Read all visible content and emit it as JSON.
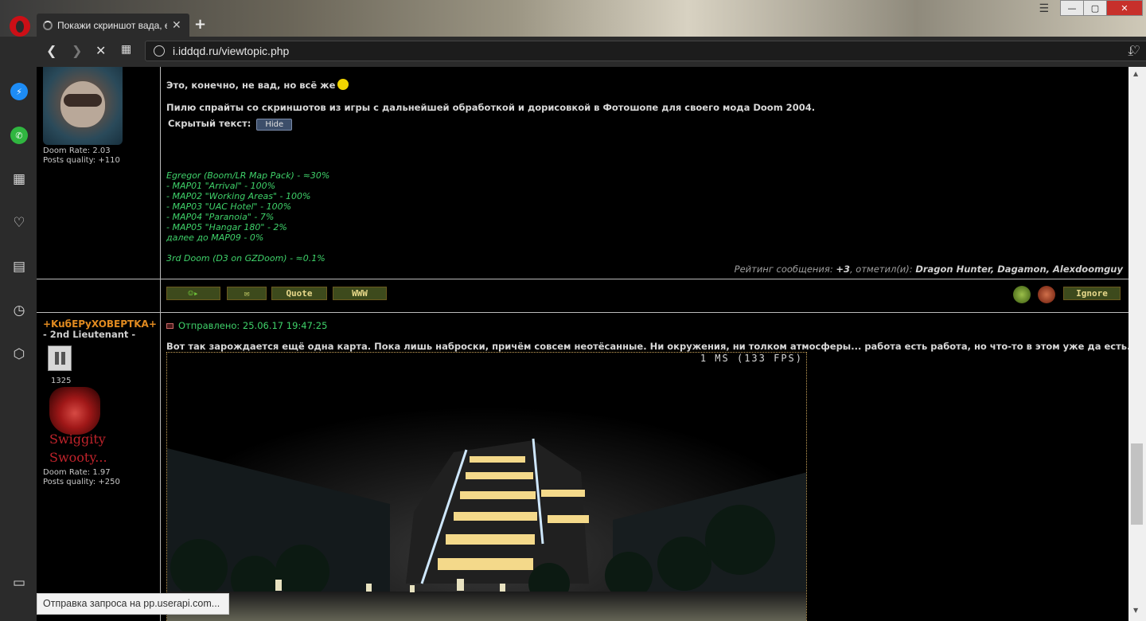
{
  "tab": {
    "title": "Покажи скриншот вада, если",
    "close_glyph": "✕"
  },
  "toolbar": {
    "url": "i.iddqd.ru/viewtopic.php"
  },
  "window_controls": {
    "minimize": "—",
    "maximize": "▢",
    "close": "✕"
  },
  "sidebar": {
    "items": [
      {
        "name": "messenger-icon"
      },
      {
        "name": "whatsapp-icon"
      },
      {
        "name": "speed-dial-icon"
      },
      {
        "name": "bookmarks-heart-icon"
      },
      {
        "name": "news-icon"
      },
      {
        "name": "history-icon"
      },
      {
        "name": "extensions-icon"
      },
      {
        "name": "sidebar-toggle-icon"
      }
    ]
  },
  "post1": {
    "author_stats": {
      "doom_rate": "Doom Rate: 2.03",
      "posts_quality": "Posts quality: +110"
    },
    "line1": "Это, конечно, не вад, но всё же",
    "line2": "Пилю спрайты со скриншотов из игры с дальнейшей обработкой и дорисовкой в Фотошопе для своего мода Doom 2004.",
    "hidden_label": "Скрытый текст:",
    "hide_button": "Hide",
    "progress": [
      "Egregor (Boom/LR Map Pack) - ≈30%",
      "- MAP01 \"Arrival\" - 100%",
      "- MAP02 \"Working Areas\" - 100%",
      "- MAP03 \"UAC Hotel\" - 100%",
      "- MAP04 \"Paranoia\" - 7%",
      "- MAP05 \"Hangar 180\" - 2%",
      "далее до MAP09 - 0%",
      "",
      "3rd Doom (D3 on GZDoom) - ≈0.1%"
    ],
    "rating_prefix": "Рейтинг сообщения:",
    "rating_value": "+3",
    "rating_mid": ", отметил(и):",
    "rating_users": "Dragon Hunter, Dagamon, Alexdoomguy",
    "buttons": {
      "quote": "Quote",
      "www": "WWW",
      "ignore": "Ignore"
    }
  },
  "post2": {
    "username": "+KuбEPуXOBEPTKA+",
    "rank": "- 2nd Lieutenant -",
    "post_count": "1325",
    "signature_line1": "Swiggity",
    "signature_line2": "Swooty...",
    "author_stats": {
      "doom_rate": "Doom Rate: 1.97",
      "posts_quality": "Posts quality: +250"
    },
    "sent": "Отправлено: 25.06.17 19:47:25",
    "text": "Вот так зарождается ещё одна карта. Пока лишь наброски, причём совсем неотёсанные. Ни окружения, ни толком атмосферы... работа есть работа, но что-то в этом уже да есть.",
    "screenshot_fps": "1 MS (133 FPS)"
  },
  "status": {
    "loading": "Отправка запроса на pp.userapi.com..."
  }
}
